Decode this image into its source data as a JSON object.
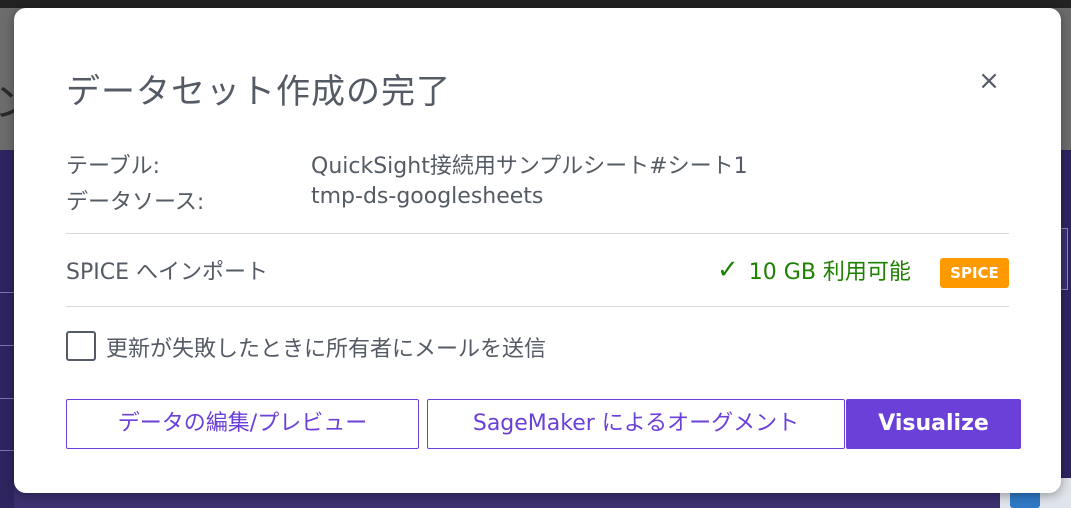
{
  "background": {
    "partial_glyph": "ン"
  },
  "dialog": {
    "title": "データセット作成の完了",
    "close_icon": "×",
    "info": {
      "table_label": "テーブル:",
      "table_value": "QuickSight接続用サンプルシート#シート1",
      "datasource_label": "データソース:",
      "datasource_value": "tmp-ds-googlesheets"
    },
    "spice": {
      "label": "SPICE へインポート",
      "check_icon": "✓",
      "status": "10 GB 利用可能",
      "badge": "SPICE",
      "status_color": "#1d8102",
      "badge_color": "#ff9900"
    },
    "notify": {
      "checked": false,
      "label": "更新が失敗したときに所有者にメールを送信"
    },
    "buttons": {
      "edit_preview": "データの編集/プレビュー",
      "sagemaker": "SageMaker によるオーグメント",
      "visualize": "Visualize"
    },
    "accent_color": "#6b40d8"
  }
}
